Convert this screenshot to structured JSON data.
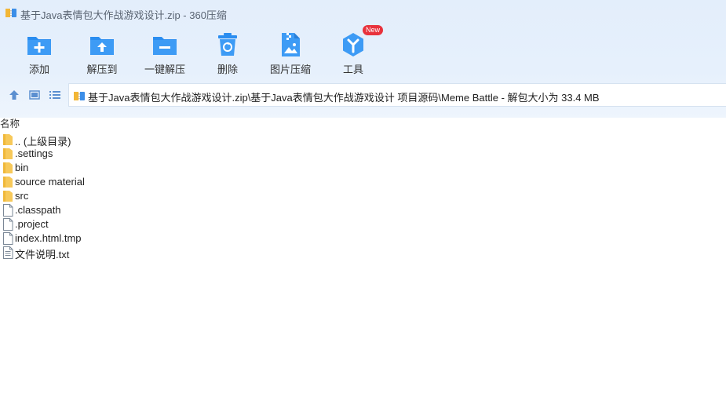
{
  "window": {
    "title": "基于Java表情包大作战游戏设计.zip - 360压缩"
  },
  "toolbar": {
    "items": [
      {
        "label": "添加",
        "icon": "add-icon"
      },
      {
        "label": "解压到",
        "icon": "extract-to-icon"
      },
      {
        "label": "一键解压",
        "icon": "one-click-extract-icon"
      },
      {
        "label": "删除",
        "icon": "delete-icon"
      },
      {
        "label": "图片压缩",
        "icon": "image-compress-icon"
      },
      {
        "label": "工具",
        "icon": "tools-icon",
        "badge": "New"
      }
    ]
  },
  "address": {
    "path": "基于Java表情包大作战游戏设计.zip\\基于Java表情包大作战游戏设计 项目源码\\Meme Battle - 解包大小为 33.4 MB"
  },
  "list": {
    "column_name": "名称",
    "files": [
      {
        "name": ".. (上级目录)",
        "type": "folder"
      },
      {
        "name": ".settings",
        "type": "folder"
      },
      {
        "name": "bin",
        "type": "folder"
      },
      {
        "name": "source material",
        "type": "folder"
      },
      {
        "name": "src",
        "type": "folder"
      },
      {
        "name": ".classpath",
        "type": "file"
      },
      {
        "name": ".project",
        "type": "file"
      },
      {
        "name": "index.html.tmp",
        "type": "file"
      },
      {
        "name": "文件说明.txt",
        "type": "text"
      }
    ]
  },
  "colors": {
    "accent": "#2a8df0",
    "folder": "#f7c95a",
    "badge": "#e8323c"
  }
}
